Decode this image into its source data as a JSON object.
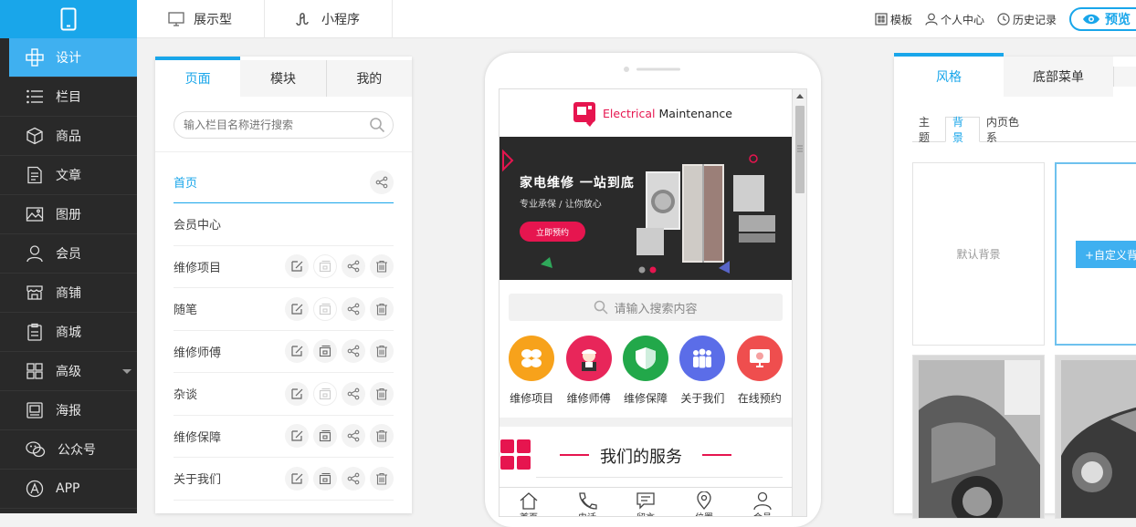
{
  "sidebar": {
    "items": [
      {
        "label": "设计",
        "icon": "design-icon"
      },
      {
        "label": "栏目",
        "icon": "list-icon"
      },
      {
        "label": "商品",
        "icon": "box-icon"
      },
      {
        "label": "文章",
        "icon": "document-icon"
      },
      {
        "label": "图册",
        "icon": "image-icon"
      },
      {
        "label": "会员",
        "icon": "user-icon"
      },
      {
        "label": "商铺",
        "icon": "shop-icon"
      },
      {
        "label": "商城",
        "icon": "clipboard-icon"
      },
      {
        "label": "高级",
        "icon": "grid-icon"
      },
      {
        "label": "海报",
        "icon": "poster-icon"
      },
      {
        "label": "公众号",
        "icon": "wechat-icon"
      },
      {
        "label": "APP",
        "icon": "app-icon"
      }
    ]
  },
  "topbar": {
    "tab1": "展示型",
    "tab2": "小程序",
    "template": "模板",
    "user_center": "个人中心",
    "history": "历史记录",
    "preview": "预览"
  },
  "left_panel": {
    "tabs": [
      "页面",
      "模块",
      "我的"
    ],
    "search_placeholder": "输入栏目名称进行搜索",
    "pages": [
      "首页",
      "会员中心",
      "维修项目",
      "随笔",
      "维修师傅",
      "杂谈",
      "维修保障",
      "关于我们"
    ]
  },
  "phone": {
    "brand_red": "Electrical",
    "brand_dark": "Maintenance",
    "banner_title": "家电维修  一站到底",
    "banner_sub": "专业承保 / 让你放心",
    "banner_btn": "立即预约",
    "search_placeholder": "请输入搜索内容",
    "icons": [
      {
        "label": "维修项目",
        "color": "#f7a21b"
      },
      {
        "label": "维修师傅",
        "color": "#e8265a"
      },
      {
        "label": "维修保障",
        "color": "#22a84a"
      },
      {
        "label": "关于我们",
        "color": "#5b6de8"
      },
      {
        "label": "在线预约",
        "color": "#ef4e4e"
      }
    ],
    "section_title": "我们的服务",
    "tabbar": [
      "首页",
      "电话",
      "留言",
      "位置",
      "会员"
    ]
  },
  "right_panel": {
    "tabs": [
      "风格",
      "底部菜单"
    ],
    "subtabs": [
      "主题",
      "背景",
      "内页色系"
    ],
    "default_bg": "默认背景",
    "custom_bg": "+自定义背景"
  },
  "colors": {
    "accent": "#19a6ea",
    "sidebar": "#292929",
    "brand_red": "#e6154f"
  }
}
